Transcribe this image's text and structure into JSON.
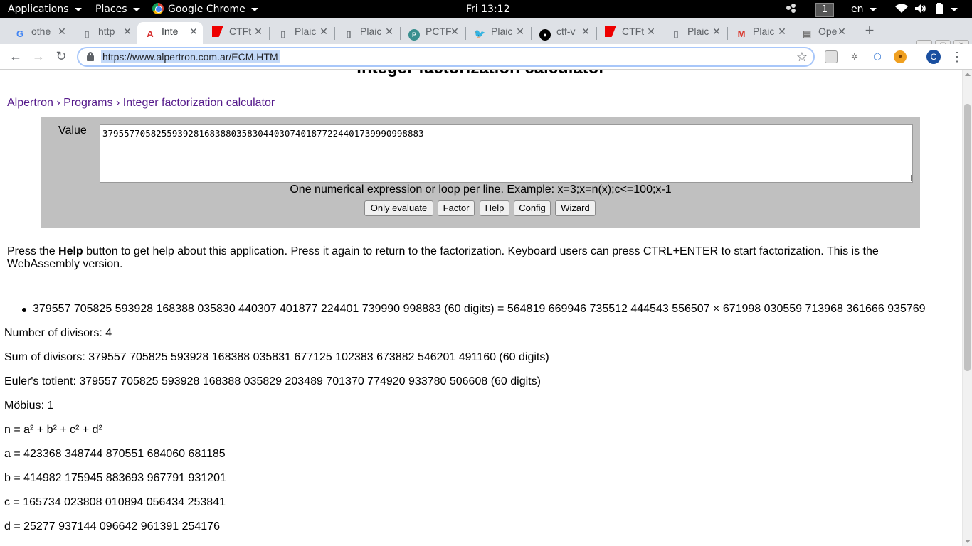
{
  "system_bar": {
    "applications": "Applications",
    "places": "Places",
    "app_name": "Google Chrome",
    "clock": "Fri 13:12",
    "workspace": "1",
    "language": "en"
  },
  "tabs": [
    {
      "icon": "google-icon",
      "title": "othe"
    },
    {
      "icon": "page-icon",
      "title": "http"
    },
    {
      "icon": "alpertron-icon",
      "title": "Inte"
    },
    {
      "icon": "ctf-icon",
      "title": "CTFt"
    },
    {
      "icon": "page-icon",
      "title": "Plaic"
    },
    {
      "icon": "page-icon",
      "title": "Plaic"
    },
    {
      "icon": "pctf-icon",
      "title": "PCTF"
    },
    {
      "icon": "twitter-icon",
      "title": "Plaic"
    },
    {
      "icon": "github-icon",
      "title": "ctf-v"
    },
    {
      "icon": "ctf-icon",
      "title": "CTFt"
    },
    {
      "icon": "page-icon",
      "title": "Plaic"
    },
    {
      "icon": "gmail-icon",
      "title": "Plaic"
    },
    {
      "icon": "page-icon",
      "title": "Ope"
    }
  ],
  "omnibox": {
    "url": "https://www.alpertron.com.ar/ECM.HTM",
    "profile_initial": "C"
  },
  "page": {
    "heading": "Integer factorization calculator",
    "breadcrumb": {
      "home": "Alpertron",
      "programs": "Programs",
      "current": "Integer factorization calculator",
      "separator": "›"
    },
    "value_label": "Value",
    "value_input": "379557705825593928168388035830440307401877224401739990998883",
    "hint": "One numerical expression or loop per line. Example: x=3;x=n(x);c<=100;x-1",
    "buttons": {
      "only_evaluate": "Only evaluate",
      "factor": "Factor",
      "help": "Help",
      "config": "Config",
      "wizard": "Wizard"
    },
    "help_text": {
      "pre": "Press the ",
      "bold": "Help",
      "post": " button to get help about this application. Press it again to return to the factorization. Keyboard users can press CTRL+ENTER to start factorization. This is the WebAssembly version."
    },
    "result": "379557 705825 593928 168388 035830 440307 401877 224401 739990 998883 (60 digits) = 564819 669946 735512 444543 556507 × 671998 030559 713968 361666 935769",
    "stats": {
      "divisors_count": "Number of divisors: 4",
      "divisors_sum": "Sum of divisors: 379557 705825 593928 168388 035831 677125 102383 673882 546201 491160 (60 digits)",
      "totient": "Euler's totient: 379557 705825 593928 168388 035829 203489 701370 774920 933780 506608 (60 digits)",
      "mobius": "Möbius: 1",
      "sum_of_squares": "n = a² + b² + c² + d²",
      "a": "a = 423368 348744 870551 684060 681185",
      "b": "b = 414982 175945 883693 967791 931201",
      "c": "c = 165734 023808 010894 056434 253841",
      "d": "d = 25277 937144 096642 961391 254176"
    }
  }
}
